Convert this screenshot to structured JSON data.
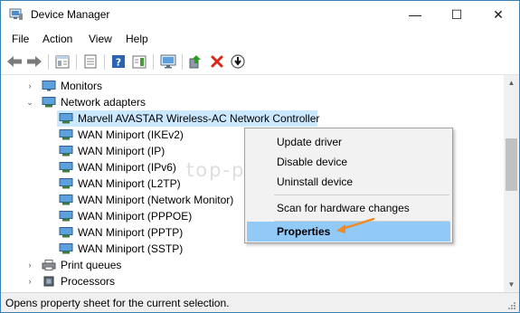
{
  "window": {
    "title": "Device Manager",
    "controls": {
      "minimize": "—",
      "maximize": "☐",
      "close": "✕"
    }
  },
  "menu": [
    "File",
    "Action",
    "View",
    "Help"
  ],
  "toolbar": {
    "buttons": [
      "back-icon",
      "forward-icon",
      "show-hide-console-tree-icon",
      "properties-sheet-icon",
      "help-icon",
      "action-pane-icon",
      "monitor-scan-icon",
      "update-driver-icon",
      "uninstall-icon",
      "disable-device-icon"
    ],
    "colors": {
      "uninstall": "#d8261b",
      "update": "#2c9a2c"
    }
  },
  "tree": {
    "monitors": "Monitors",
    "network_adapters": "Network adapters",
    "adapters": [
      "Marvell AVASTAR Wireless-AC Network Controller",
      "WAN Miniport (IKEv2)",
      "WAN Miniport (IP)",
      "WAN Miniport (IPv6)",
      "WAN Miniport (L2TP)",
      "WAN Miniport (Network Monitor)",
      "WAN Miniport (PPPOE)",
      "WAN Miniport (PPTP)",
      "WAN Miniport (SSTP)"
    ],
    "print_queues": "Print queues",
    "processors": "Processors"
  },
  "context_menu": {
    "update_driver": "Update driver",
    "disable_device": "Disable device",
    "uninstall_device": "Uninstall device",
    "scan_hardware": "Scan for hardware changes",
    "properties": "Properties",
    "highlight_color": "#91c9f7"
  },
  "watermark": "top-password.com",
  "status": "Opens property sheet for the current selection.",
  "colors": {
    "selection": "#cce8ff",
    "annotation_arrow": "#f08a24",
    "border": "#3c7fb1"
  }
}
